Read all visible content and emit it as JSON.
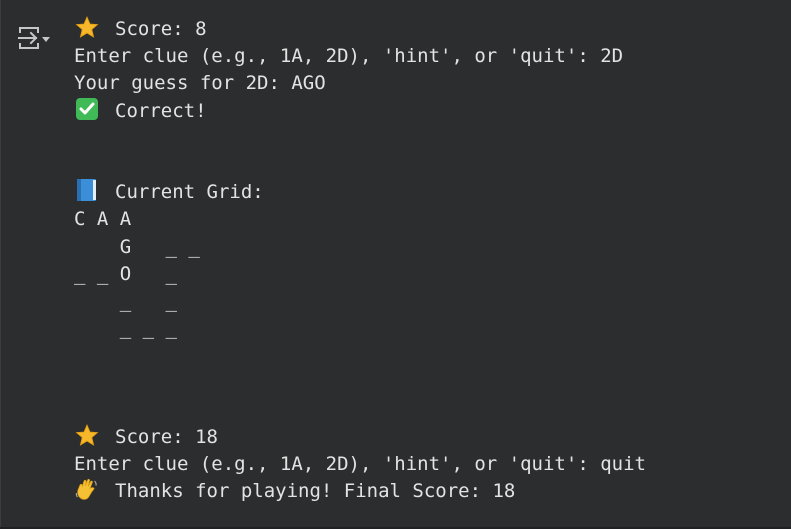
{
  "output": {
    "lines": [
      {
        "icon": "star-icon",
        "text": "Score: 8"
      },
      {
        "icon": null,
        "text": "Enter clue (e.g., 1A, 2D), 'hint', or 'quit': 2D"
      },
      {
        "icon": null,
        "text": "Your guess for 2D: AGO"
      },
      {
        "icon": "check-mark-icon",
        "text": "Correct!"
      },
      {
        "icon": null,
        "text": ""
      },
      {
        "icon": null,
        "text": ""
      },
      {
        "icon": "blue-book-icon",
        "text": "Current Grid:"
      },
      {
        "icon": null,
        "text": "C A A"
      },
      {
        "icon": null,
        "text": "    G   _ _"
      },
      {
        "icon": null,
        "text": "_ _ O   _"
      },
      {
        "icon": null,
        "text": "    _   _"
      },
      {
        "icon": null,
        "text": "    _ _ _"
      },
      {
        "icon": null,
        "text": ""
      },
      {
        "icon": null,
        "text": ""
      },
      {
        "icon": null,
        "text": ""
      },
      {
        "icon": "star-icon",
        "text": "Score: 18"
      },
      {
        "icon": null,
        "text": "Enter clue (e.g., 1A, 2D), 'hint', or 'quit': quit"
      },
      {
        "icon": "waving-hand-icon",
        "text": "Thanks for playing! Final Score: 18"
      }
    ]
  },
  "colors": {
    "background": "#2b2d2e",
    "text": "#e3e3e3",
    "toggle_icon": "#c4c7c5"
  }
}
